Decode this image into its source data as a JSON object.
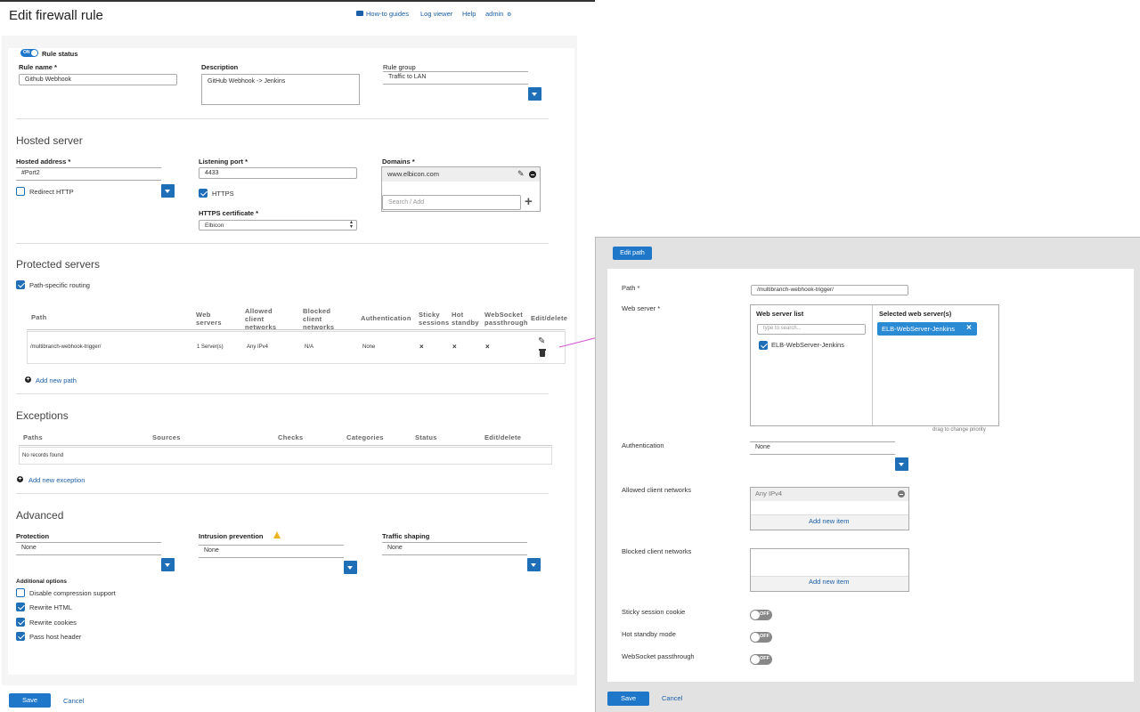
{
  "page_title": "Edit firewall rule",
  "top_nav": {
    "how_to": "How-to guides",
    "log_viewer": "Log viewer",
    "help": "Help",
    "user": "admin"
  },
  "rule": {
    "status_toggle": "ON",
    "status_label": "Rule status",
    "name_label": "Rule name *",
    "name_value": "Github Webhook",
    "description_label": "Description",
    "description_value": "GitHub Webhook -> Jenkins",
    "group_label": "Rule group",
    "group_value": "Traffic to LAN"
  },
  "hosted": {
    "title": "Hosted server",
    "address_label": "Hosted address *",
    "address_value": "#Port2",
    "redirect_label": "Redirect HTTP",
    "port_label": "Listening port *",
    "port_value": "4433",
    "https_label": "HTTPS",
    "cert_label": "HTTPS certificate *",
    "cert_value": "Elbicon",
    "domains_label": "Domains *",
    "domain_value": "www.elbicon.com",
    "domain_search_placeholder": "Search / Add"
  },
  "protected": {
    "title": "Protected servers",
    "routing_label": "Path-specific routing",
    "headers": [
      "Path",
      "Web servers",
      "Allowed client networks",
      "Blocked client networks",
      "Authentication",
      "Sticky sessions",
      "Hot standby",
      "WebSocket passthrough",
      "Edit/delete"
    ],
    "row": {
      "path": "/multibranch-webhook-trigger/",
      "servers": "1 Server(s)",
      "allowed": "Any IPv4",
      "blocked": "N/A",
      "auth": "None",
      "sticky": "×",
      "hot": "×",
      "ws": "×"
    },
    "add_path": "Add new path"
  },
  "exceptions": {
    "title": "Exceptions",
    "headers": [
      "Paths",
      "Sources",
      "Checks",
      "Categories",
      "Status",
      "Edit/delete"
    ],
    "empty": "No records found",
    "add": "Add new exception"
  },
  "advanced": {
    "title": "Advanced",
    "protection_label": "Protection",
    "protection_value": "None",
    "ips_label": "Intrusion prevention",
    "ips_value": "None",
    "shaping_label": "Traffic shaping",
    "shaping_value": "None",
    "additional_label": "Additional options",
    "options": [
      {
        "label": "Disable compression support",
        "checked": false
      },
      {
        "label": "Rewrite HTML",
        "checked": true
      },
      {
        "label": "Rewrite cookies",
        "checked": true
      },
      {
        "label": "Pass host header",
        "checked": true
      }
    ]
  },
  "footer": {
    "save": "Save",
    "cancel": "Cancel"
  },
  "edit_path": {
    "title": "Edit path",
    "path_label": "Path *",
    "path_value": "/multibranch-webhook-trigger/",
    "webserver_label": "Web server *",
    "list_label": "Web server list",
    "search_placeholder": "type to search...",
    "list_item": "ELB-WebServer-Jenkins",
    "selected_label": "Selected web server(s)",
    "selected_item": "ELB-WebServer-Jenkins",
    "priority_hint": "drag to change priority",
    "auth_label": "Authentication",
    "auth_value": "None",
    "allowed_label": "Allowed client networks",
    "allowed_value": "Any IPv4",
    "add_item": "Add new item",
    "blocked_label": "Blocked client networks",
    "sticky_label": "Sticky session cookie",
    "hot_label": "Hot standby mode",
    "ws_label": "WebSocket passthrough",
    "toggle_off": "OFF",
    "save": "Save",
    "cancel": "Cancel"
  },
  "colors": {
    "accent": "#1e77c9",
    "arrow": "#d24bd8"
  }
}
